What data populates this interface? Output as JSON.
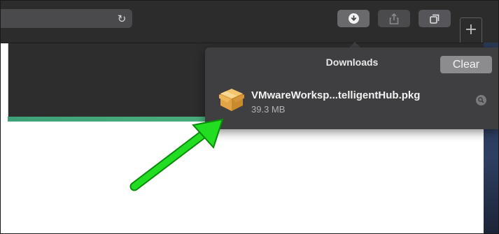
{
  "toolbar": {
    "reload_icon": "reload-icon",
    "download_icon": "download-icon",
    "share_icon": "share-icon",
    "tabs_icon": "show-tabs-icon",
    "new_tab_label": "+"
  },
  "downloads_popover": {
    "title": "Downloads",
    "clear_label": "Clear",
    "items": [
      {
        "file_name": "VMwareWorksp...telligentHub.pkg",
        "size": "39.3 MB",
        "icon": "package-icon",
        "reveal_icon": "magnifier-icon"
      }
    ]
  },
  "annotation": {
    "arrow_color": "#22dd22",
    "icon": "green-arrow"
  },
  "colors": {
    "toolbar_bg": "#2c2c2d",
    "popover_bg": "#3f3f41",
    "accent_green": "#4ab07b",
    "clear_button_bg": "#8c8c8e"
  }
}
